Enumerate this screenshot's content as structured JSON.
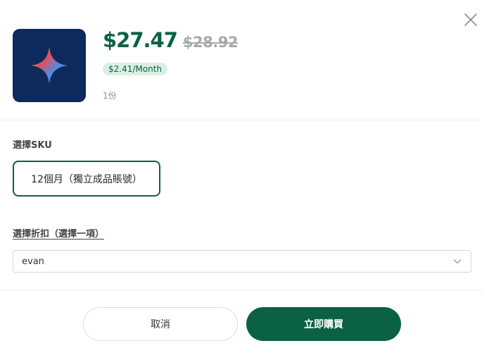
{
  "header": {
    "close_icon": "close-icon",
    "product_icon": "sparkle-icon",
    "price_current": "$27.47",
    "price_original": "$28.92",
    "monthly_badge": "$2.41/Month",
    "quantity": "1份"
  },
  "sku": {
    "label": "選擇SKU",
    "selected_option": "12個月（獨立成品賬號）"
  },
  "discount": {
    "label": "選擇折扣（選擇一項）",
    "selected_value": "evan",
    "chevron_icon": "chevron-down-icon"
  },
  "actions": {
    "cancel_label": "取消",
    "buy_label": "立即購買"
  },
  "colors": {
    "accent": "#0a6144",
    "badge_bg": "#dcefe4",
    "thumb_bg": "#0e2a5c"
  }
}
